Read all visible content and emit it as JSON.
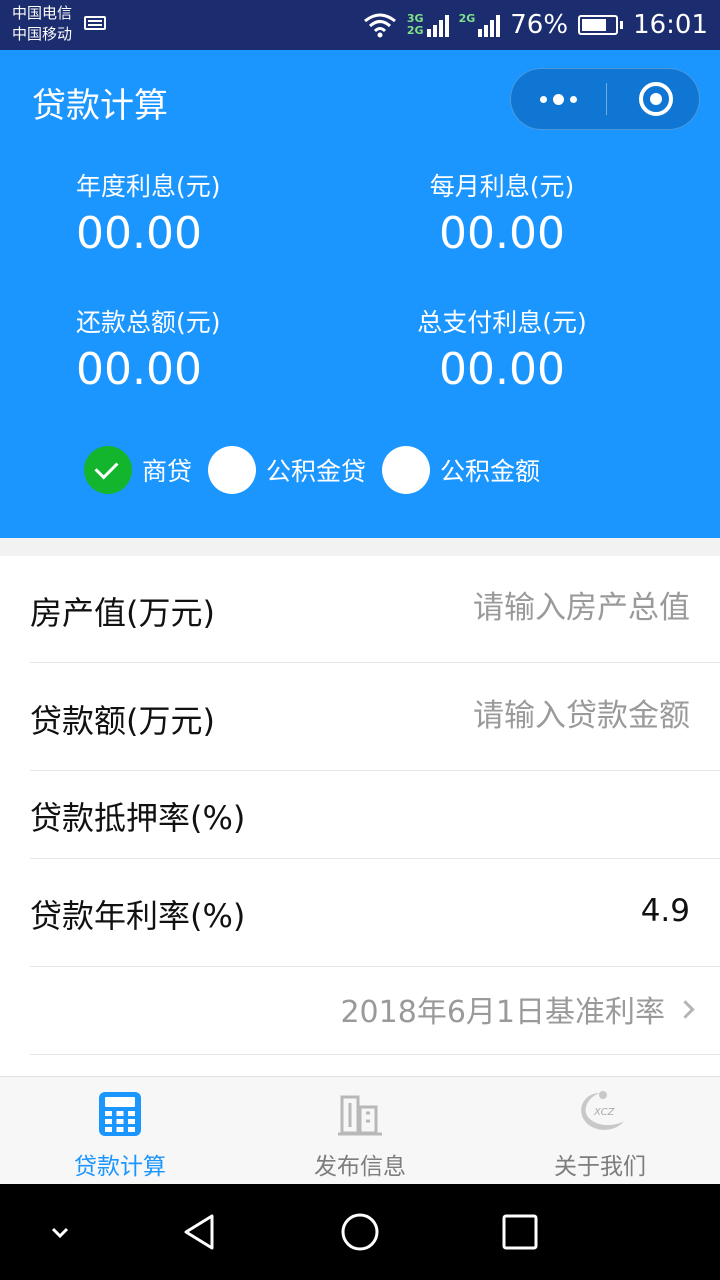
{
  "status_bar": {
    "carrier_1": "中国电信",
    "carrier_2": "中国移动",
    "net_3g": "3G",
    "net_2g_a": "2G",
    "net_2g_b": "2G",
    "battery": "76%",
    "time": "16:01",
    "battery_level": 0.76
  },
  "header": {
    "title": "贷款计算",
    "annual_interest": {
      "label": "年度利息(元)",
      "value": "00.00"
    },
    "monthly_interest": {
      "label": "每月利息(元)",
      "value": "00.00"
    },
    "total_repayment": {
      "label": "还款总额(元)",
      "value": "00.00"
    },
    "total_interest": {
      "label": "总支付利息(元)",
      "value": "00.00"
    },
    "loan_types": [
      {
        "label": "商贷",
        "checked": true
      },
      {
        "label": "公积金贷",
        "checked": false
      },
      {
        "label": "公积金额",
        "checked": false
      }
    ]
  },
  "form": {
    "property_value": {
      "label": "房产值(万元)",
      "placeholder": "请输入房产总值",
      "value": ""
    },
    "loan_amount": {
      "label": "贷款额(万元)",
      "placeholder": "请输入贷款金额",
      "value": ""
    },
    "mortgage_rate": {
      "label": "贷款抵押率(%)",
      "value": ""
    },
    "annual_rate": {
      "label": "贷款年利率(%)",
      "value": "4.9"
    },
    "base_rate_link": "2018年6月1日基准利率"
  },
  "tabbar": {
    "tabs": [
      {
        "label": "贷款计算",
        "active": true,
        "icon": "calculator-icon"
      },
      {
        "label": "发布信息",
        "active": false,
        "icon": "building-icon"
      },
      {
        "label": "关于我们",
        "active": false,
        "icon": "xcz-logo-icon"
      }
    ]
  },
  "colors": {
    "primary": "#1c96ff",
    "check": "#12b52b",
    "status_bar": "#1b2d6e"
  }
}
